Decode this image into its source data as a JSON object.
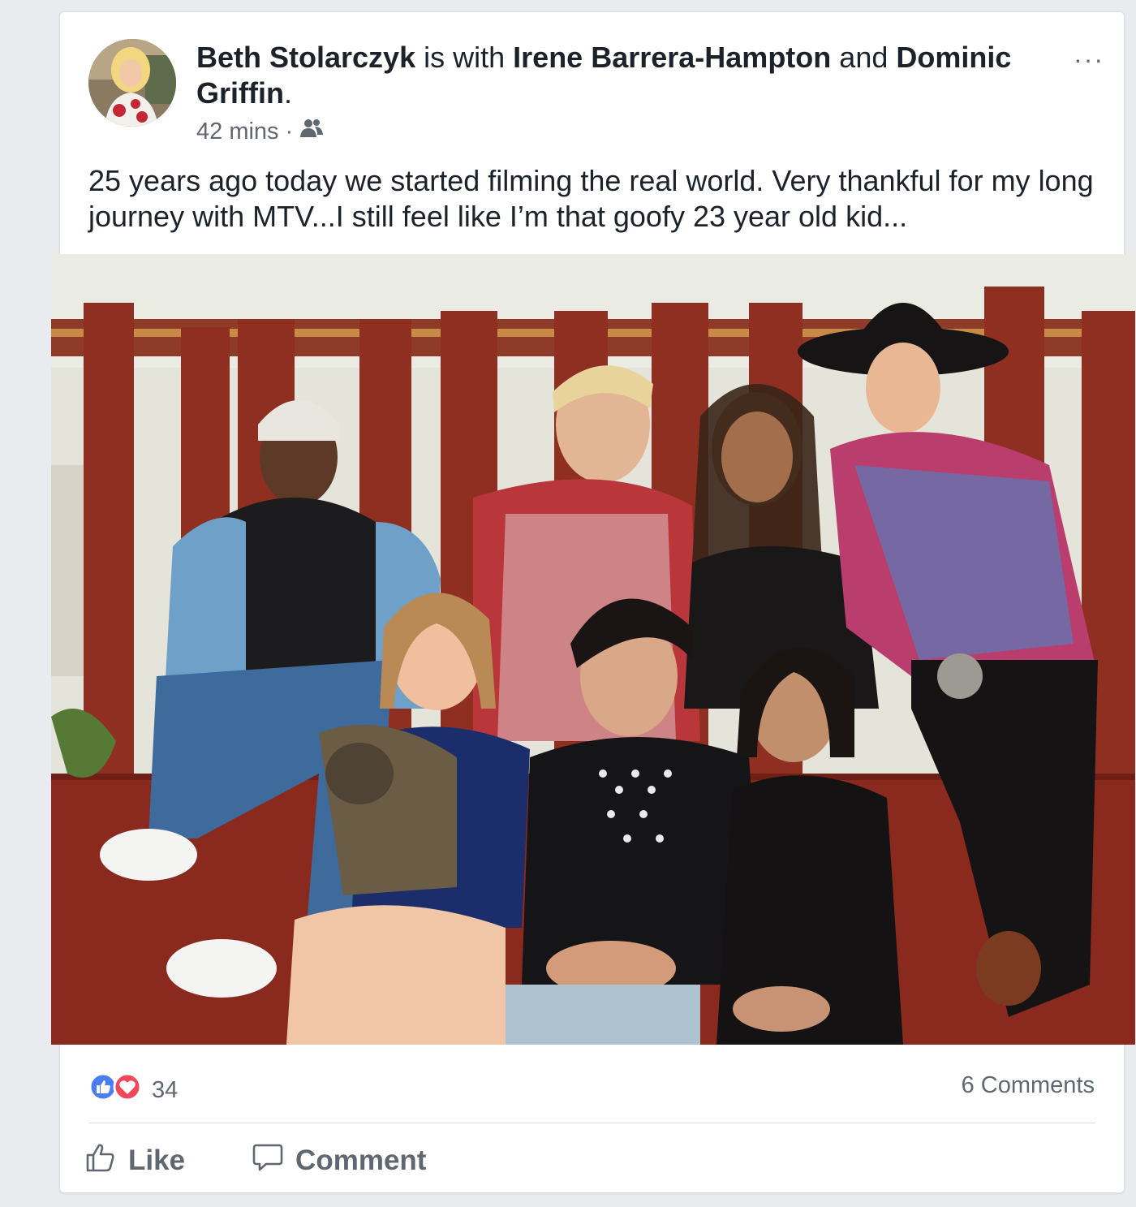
{
  "post": {
    "author": "Beth Stolarczyk",
    "with_text": "is with",
    "tagged_1": "Irene Barrera-Hampton",
    "and_text": "and",
    "tagged_2": "Dominic Griffin",
    "end_punct": ".",
    "time": "42 mins",
    "separator": "·",
    "audience_icon": "friends-icon",
    "text": "25 years ago today we started filming the real world. Very thankful for my long journey with MTV...I still feel like I’m that goofy 23 year old kid...",
    "more_icon": "···"
  },
  "reactions": {
    "count": "34",
    "icons": [
      "like-reaction-icon",
      "love-reaction-icon"
    ],
    "like_color": "#4a7cf5",
    "love_color": "#f0475a"
  },
  "comments_label": "6 Comments",
  "actions": {
    "like": "Like",
    "comment": "Comment"
  }
}
